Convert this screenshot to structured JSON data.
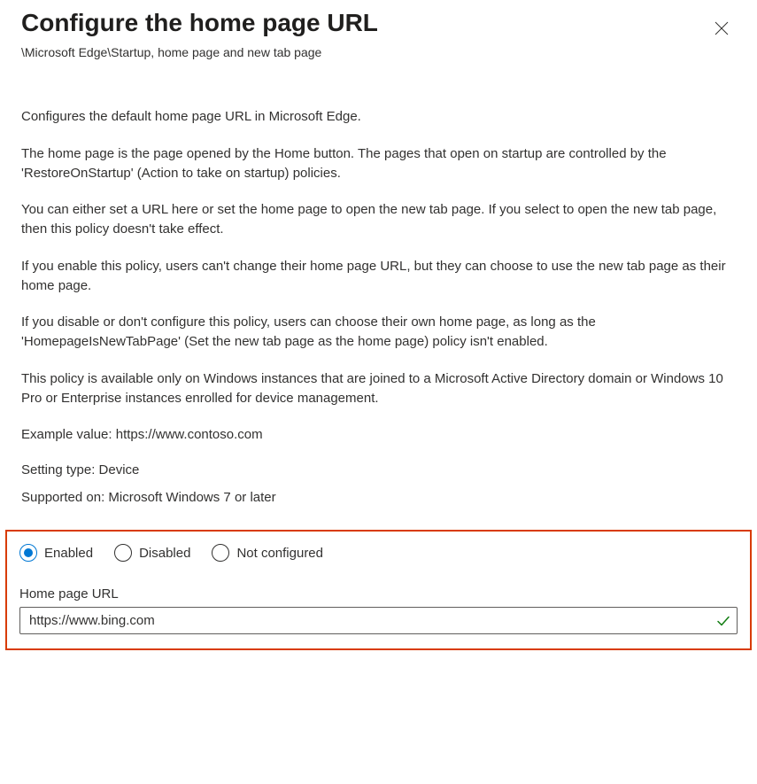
{
  "header": {
    "title": "Configure the home page URL",
    "breadcrumb": "\\Microsoft Edge\\Startup, home page and new tab page"
  },
  "description": {
    "p1": "Configures the default home page URL in Microsoft Edge.",
    "p2": "The home page is the page opened by the Home button. The pages that open on startup are controlled by the 'RestoreOnStartup' (Action to take on startup) policies.",
    "p3": "You can either set a URL here or set the home page to open the new tab page. If you select to open the new tab page, then this policy doesn't take effect.",
    "p4": "If you enable this policy, users can't change their home page URL, but they can choose to use the new tab page as their home page.",
    "p5": "If you disable or don't configure this policy, users can choose their own home page, as long as the 'HomepageIsNewTabPage' (Set the new tab page as the home page) policy isn't enabled.",
    "p6": "This policy is available only on Windows instances that are joined to a Microsoft Active Directory domain or Windows 10 Pro or Enterprise instances enrolled for device management.",
    "example": "Example value: https://www.contoso.com"
  },
  "meta": {
    "setting_type": "Setting type: Device",
    "supported_on": "Supported on: Microsoft Windows 7 or later"
  },
  "radios": {
    "enabled": "Enabled",
    "disabled": "Disabled",
    "not_configured": "Not configured",
    "selected": "enabled"
  },
  "field": {
    "label": "Home page URL",
    "value": "https://www.bing.com"
  }
}
